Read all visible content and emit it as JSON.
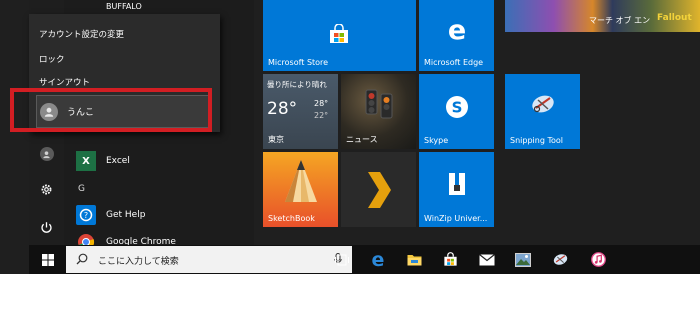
{
  "start_menu": {
    "user_flyout": {
      "items": [
        {
          "label": "アカウント設定の変更"
        },
        {
          "label": "ロック"
        },
        {
          "label": "サインアウト"
        }
      ],
      "other_user": "うんこ"
    },
    "app_list": {
      "top_partial": "BUFFALO",
      "items": [
        {
          "label": "Excel",
          "icon": "excel-icon"
        },
        {
          "label": "Get Help",
          "icon": "get-help-icon"
        },
        {
          "label": "Google Chrome",
          "icon": "chrome-icon"
        }
      ],
      "group_letter": "G"
    },
    "tiles": {
      "store": "Microsoft Store",
      "edge": "Microsoft Edge",
      "weather": {
        "condition": "曇り所により晴れ",
        "temp": "28°",
        "high": "28°",
        "low": "22°",
        "city": "東京"
      },
      "news": "ニュース",
      "skype": "Skype",
      "snipping": "Snipping Tool",
      "sketchbook": "SketchBook",
      "winzip": "WinZip Univer...",
      "game1": "マーチ オブ エン",
      "game2": "Fallout"
    }
  },
  "taskbar": {
    "search_placeholder": "ここに入力して検索"
  },
  "colors": {
    "accent_tile": "#0078d7",
    "highlight": "#d21e23",
    "taskbar": "#101010"
  }
}
